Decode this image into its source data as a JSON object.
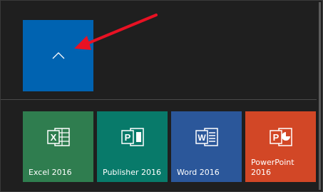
{
  "colors": {
    "background": "#1f1f1f",
    "collapse_tile": "#0063b1",
    "annotation_arrow": "#e81123"
  },
  "collapse_tile": {
    "icon": "chevron-up-icon"
  },
  "tiles": [
    {
      "label": "Excel 2016",
      "color": "#2f7d4f",
      "icon": "excel-icon",
      "letter": "X"
    },
    {
      "label": "Publisher 2016",
      "color": "#087a6a",
      "icon": "publisher-icon",
      "letter": "P"
    },
    {
      "label": "Word 2016",
      "color": "#2b579a",
      "icon": "word-icon",
      "letter": "W"
    },
    {
      "label": "PowerPoint 2016",
      "color": "#d24726",
      "icon": "powerpoint-icon",
      "letter": "P"
    }
  ]
}
